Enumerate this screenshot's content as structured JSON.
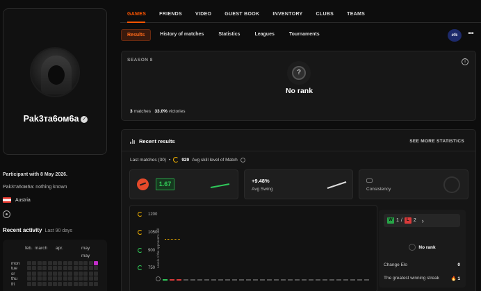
{
  "profile": {
    "nickname": "Pak3та6ом6а",
    "participant_since": "Participant with 8 May 2026.",
    "bio": "Pak3та6ом6а: nothing known",
    "country": "Austria"
  },
  "activity": {
    "title": "Recent activity",
    "period": "Last 90 days",
    "months": [
      "feb.",
      "march",
      "apr.",
      "may",
      "may"
    ],
    "days": [
      "mon",
      "tue",
      "sr",
      "thu",
      "fri"
    ]
  },
  "nav": {
    "items": [
      "GAMES",
      "FRIENDS",
      "VIDEO",
      "GUEST BOOK",
      "INVENTORY",
      "CLUBS",
      "TEAMS"
    ],
    "subtabs": [
      "Results",
      "History of matches",
      "Statistics",
      "Leagues",
      "Tournaments"
    ],
    "badge": "cfs",
    "more": "•••"
  },
  "season": {
    "label": "SEASON 8",
    "rank": "No rank",
    "matches_value": "3",
    "matches_label": "matches",
    "victories_value": "33.0%",
    "victories_label": "victories",
    "info": "i",
    "rank_glyph": "?"
  },
  "results": {
    "title": "Recent results",
    "see_more": "SEE MORE STATISTICS",
    "last_matches": "Last matches (30)",
    "avg_value": "929",
    "avg_label": "Avg skill level of Match",
    "elo_value": "1.67",
    "swing_value": "+9.48%",
    "swing_label": "Avg Swing",
    "consistency_label": "Consistency"
  },
  "chart": {
    "ticks": [
      "1200",
      "1050",
      "900",
      "750"
    ],
    "ylabel": "Levels of the opponent's skill"
  },
  "streak": {
    "w_tag": "W",
    "w_count": "1",
    "sep": "/",
    "l_tag": "L",
    "l_count": "2",
    "arrow": "›",
    "rank": "No rank",
    "change_elo_label": "Change Elo",
    "change_elo_value": "0",
    "greatest_label": "The greatest winning streak",
    "greatest_value": "1"
  },
  "colors": {
    "accent": "#ff5500",
    "win": "#27a347",
    "loss": "#d93a3a",
    "activity": "#c22ec9"
  }
}
